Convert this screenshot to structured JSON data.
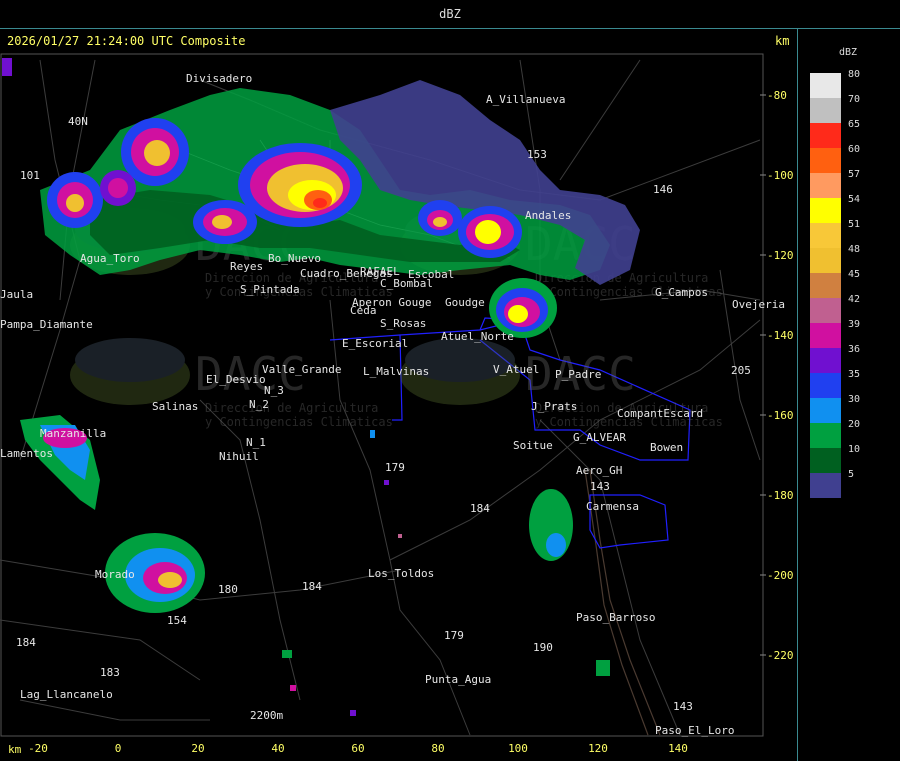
{
  "title": "dBZ",
  "header": "2026/01/27 21:24:00 UTC Composite",
  "km_label_top": "km",
  "km_label_bottom": "km",
  "legend": {
    "title": "dBZ",
    "entries": [
      {
        "value": "80",
        "color": "#e8e8e8"
      },
      {
        "value": "70",
        "color": "#c0c0c0"
      },
      {
        "value": "65",
        "color": "#ff2a1a"
      },
      {
        "value": "60",
        "color": "#ff6010"
      },
      {
        "value": "57",
        "color": "#ff9a60"
      },
      {
        "value": "54",
        "color": "#ffff00"
      },
      {
        "value": "51",
        "color": "#f8c838"
      },
      {
        "value": "48",
        "color": "#f0c030"
      },
      {
        "value": "45",
        "color": "#d08040"
      },
      {
        "value": "42",
        "color": "#c06090"
      },
      {
        "value": "39",
        "color": "#d010a0"
      },
      {
        "value": "36",
        "color": "#7010d0"
      },
      {
        "value": "35",
        "color": "#2040f0"
      },
      {
        "value": "30",
        "color": "#1090f0"
      },
      {
        "value": "20",
        "color": "#00a040"
      },
      {
        "value": "10",
        "color": "#006020"
      },
      {
        "value": "5",
        "color": "#404090"
      }
    ]
  },
  "axes": {
    "x_ticks": [
      "-20",
      "0",
      "20",
      "40",
      "60",
      "80",
      "100",
      "120",
      "140"
    ],
    "y_ticks": [
      "-80",
      "-100",
      "-120",
      "-140",
      "-160",
      "-180",
      "-200",
      "-220"
    ]
  },
  "places": [
    {
      "name": "Divisadero"
    },
    {
      "name": "A_Villanueva"
    },
    {
      "name": "40N"
    },
    {
      "name": "101"
    },
    {
      "name": "153"
    },
    {
      "name": "146"
    },
    {
      "name": "Agua_Toro"
    },
    {
      "name": "Andales"
    },
    {
      "name": "Reyes"
    },
    {
      "name": "Bo_Nuevo"
    },
    {
      "name": "S_Pintada"
    },
    {
      "name": "Cuadro_Benegas"
    },
    {
      "name": "RAFAEL"
    },
    {
      "name": "Escobal"
    },
    {
      "name": "C_Bombal"
    },
    {
      "name": "Aperon Gouge"
    },
    {
      "name": "Ceda"
    },
    {
      "name": "S_Rosas"
    },
    {
      "name": "Goudge"
    },
    {
      "name": "G_Campos"
    },
    {
      "name": "Ovejeria"
    },
    {
      "name": "Pampa_Diamante"
    },
    {
      "name": "Jaula"
    },
    {
      "name": "E_Escorial"
    },
    {
      "name": "Atuel_Norte"
    },
    {
      "name": "Valle_Grande"
    },
    {
      "name": "L_Malvinas"
    },
    {
      "name": "V_Atuel"
    },
    {
      "name": "P_Padre"
    },
    {
      "name": "205"
    },
    {
      "name": "El_Desvio"
    },
    {
      "name": "Salinas"
    },
    {
      "name": "N_2"
    },
    {
      "name": "N_3"
    },
    {
      "name": "N_1"
    },
    {
      "name": "Nihuil"
    },
    {
      "name": "Manzanilla"
    },
    {
      "name": "Lamentos"
    },
    {
      "name": "J_Prats"
    },
    {
      "name": "CompantEscard"
    },
    {
      "name": "G_ALVEAR"
    },
    {
      "name": "Bowen"
    },
    {
      "name": "Soitue"
    },
    {
      "name": "Aero_GH"
    },
    {
      "name": "179"
    },
    {
      "name": "184"
    },
    {
      "name": "143"
    },
    {
      "name": "Carmensa"
    },
    {
      "name": "Morado"
    },
    {
      "name": "Los_Toldos"
    },
    {
      "name": "180"
    },
    {
      "name": "184"
    },
    {
      "name": "Paso_Barroso"
    },
    {
      "name": "184"
    },
    {
      "name": "179"
    },
    {
      "name": "190"
    },
    {
      "name": "183"
    },
    {
      "name": "Lag_Llancanelo"
    },
    {
      "name": "Punta_Agua"
    },
    {
      "name": "2200m"
    },
    {
      "name": "143"
    },
    {
      "name": "Paso_El_Loro"
    },
    {
      "name": "154"
    }
  ],
  "watermarks": [
    {
      "brand": "DACC",
      "line1": "Direccion de Agricultura",
      "line2": "y Contingencias Climaticas"
    },
    {
      "brand": "DACC",
      "line1": "Direccion de Agricultura",
      "line2": "y Contingencias Climaticas"
    },
    {
      "brand": "DACC",
      "line1": "Direccion de Agricultura",
      "line2": "y Contingencias Climaticas"
    },
    {
      "brand": "DACC",
      "line1": "Direccion de Agricultura",
      "line2": "y Contingencias Climaticas"
    }
  ],
  "colors": {
    "frame": "#3a8a90",
    "axis_text": "#ffff66",
    "place_text": "#e6e6e6",
    "river": "#3a3a3a",
    "district": "#2020ff"
  }
}
